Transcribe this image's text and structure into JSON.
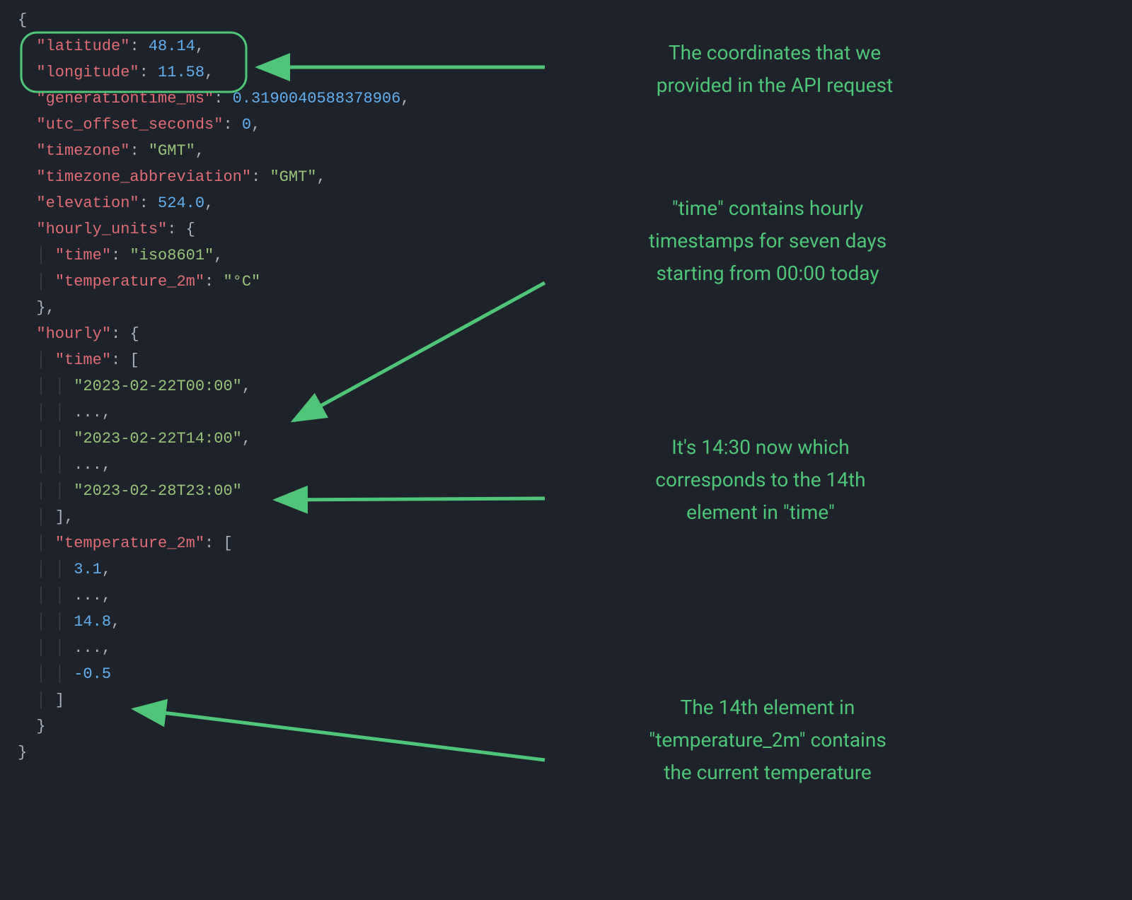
{
  "json": {
    "latitude_key": "\"latitude\"",
    "latitude_val": "48.14",
    "longitude_key": "\"longitude\"",
    "longitude_val": "11.58",
    "generationtime_key": "\"generationtime_ms\"",
    "generationtime_val": "0.3190040588378906",
    "utc_offset_key": "\"utc_offset_seconds\"",
    "utc_offset_val": "0",
    "timezone_key": "\"timezone\"",
    "timezone_val": "\"GMT\"",
    "tz_abbrev_key": "\"timezone_abbreviation\"",
    "tz_abbrev_val": "\"GMT\"",
    "elevation_key": "\"elevation\"",
    "elevation_val": "524.0",
    "hourly_units_key": "\"hourly_units\"",
    "hu_time_key": "\"time\"",
    "hu_time_val": "\"iso8601\"",
    "hu_temp_key": "\"temperature_2m\"",
    "hu_temp_val": "\"°C\"",
    "hourly_key": "\"hourly\"",
    "h_time_key": "\"time\"",
    "t0": "\"2023-02-22T00:00\"",
    "ell": "...",
    "t14": "\"2023-02-22T14:00\"",
    "tlast": "\"2023-02-28T23:00\"",
    "h_temp_key": "\"temperature_2m\"",
    "temp0": "3.1",
    "temp14": "14.8",
    "templast": "-0.5"
  },
  "annotations": {
    "a1": "The coordinates that we\nprovided in the API request",
    "a2": "\"time\" contains hourly\ntimestamps for seven days\nstarting from 00:00 today",
    "a3": "It's 14:30 now which\ncorresponds to the 14th\nelement in \"time\"",
    "a4": "The 14th element in\n\"temperature_2m\" contains\nthe current temperature"
  }
}
